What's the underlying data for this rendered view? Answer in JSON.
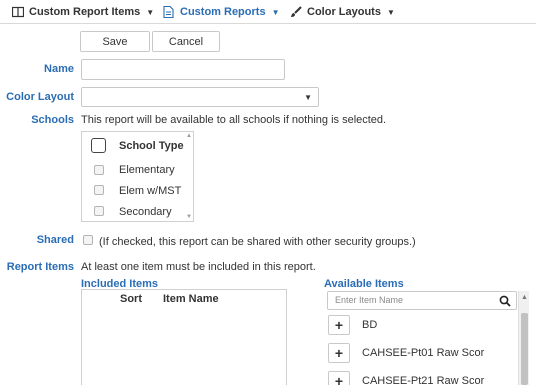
{
  "menubar": {
    "items": [
      {
        "label": "Custom Report Items",
        "icon": "table-icon"
      },
      {
        "label": "Custom Reports",
        "icon": "document-icon"
      },
      {
        "label": "Color Layouts",
        "icon": "paintbrush-icon"
      }
    ]
  },
  "actions": {
    "save_label": "Save",
    "cancel_label": "Cancel"
  },
  "form": {
    "name_label": "Name",
    "name_value": "",
    "color_layout_label": "Color Layout",
    "color_layout_value": "",
    "schools_label": "Schools",
    "schools_hint": "This report will be available to all schools if nothing is selected.",
    "schools": {
      "header": "School Type",
      "items": [
        "Elementary",
        "Elem w/MST",
        "Secondary"
      ]
    },
    "shared_label": "Shared",
    "shared_hint": "(If checked, this report can be shared with other security groups.)",
    "report_items_label": "Report Items",
    "report_items_hint": "At least one item must be included in this report."
  },
  "included": {
    "title": "Included Items",
    "columns": [
      "Sort",
      "Item Name"
    ]
  },
  "available": {
    "title": "Available Items",
    "search_placeholder": "Enter Item Name",
    "items": [
      "BD",
      "CAHSEE-Pt01 Raw Scor",
      "CAHSEE-Pt21 Raw Scor"
    ]
  },
  "colors": {
    "accent": "#2a6db5",
    "border": "#c9c9c9",
    "text": "#333333"
  }
}
